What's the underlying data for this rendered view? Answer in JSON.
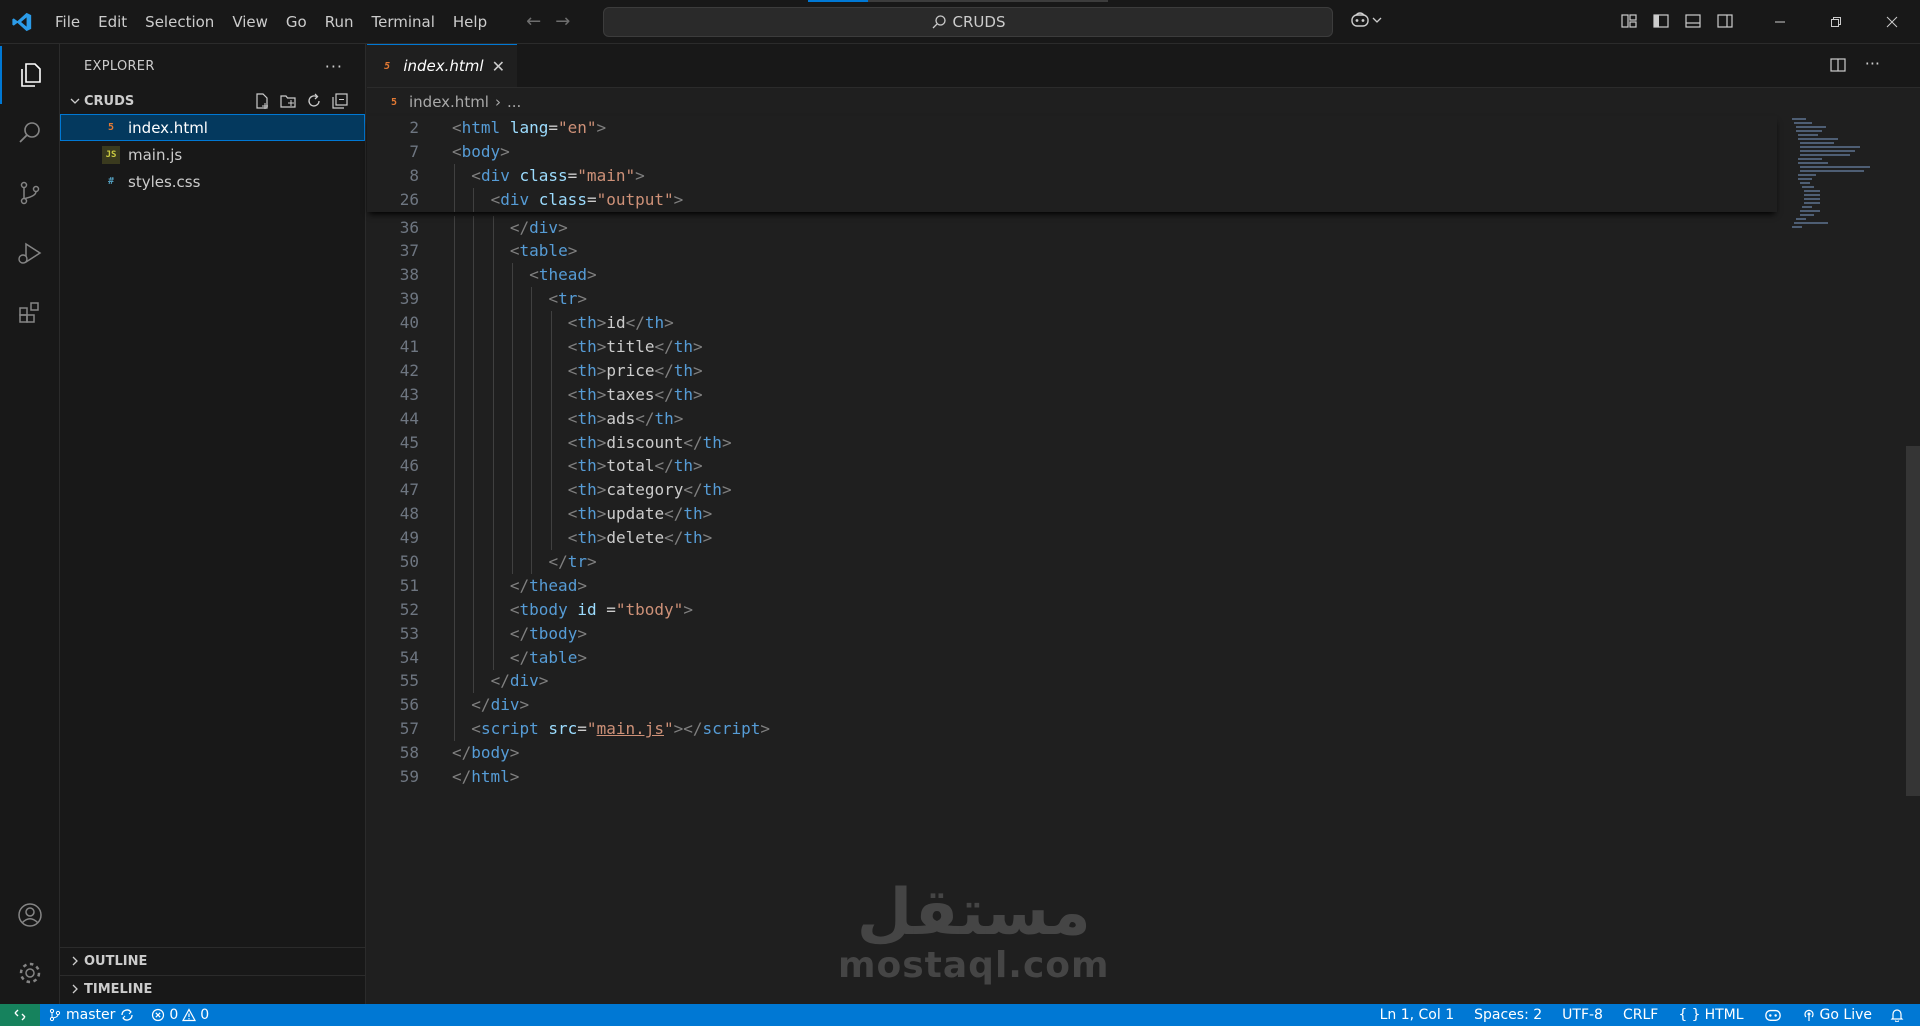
{
  "menu": [
    "File",
    "Edit",
    "Selection",
    "View",
    "Go",
    "Run",
    "Terminal",
    "Help"
  ],
  "search": {
    "label": "CRUDS"
  },
  "sidebar": {
    "title": "EXPLORER",
    "folder": "CRUDS",
    "files": [
      {
        "name": "index.html",
        "type": "html",
        "selected": true
      },
      {
        "name": "main.js",
        "type": "js",
        "selected": false
      },
      {
        "name": "styles.css",
        "type": "css",
        "selected": false
      }
    ],
    "sections": [
      "OUTLINE",
      "TIMELINE"
    ]
  },
  "editor": {
    "tab": "index.html",
    "breadcrumb": [
      "index.html",
      "..."
    ],
    "sticky_lines": [
      {
        "n": "2",
        "indent": 0,
        "tokens": [
          [
            "t",
            "<"
          ],
          [
            "tag",
            "html"
          ],
          [
            "txt",
            " "
          ],
          [
            "attr",
            "lang"
          ],
          [
            "txt",
            "="
          ],
          [
            "str",
            "\"en\""
          ],
          [
            "t",
            ">"
          ]
        ]
      },
      {
        "n": "7",
        "indent": 0,
        "tokens": [
          [
            "t",
            "<"
          ],
          [
            "tag",
            "body"
          ],
          [
            "t",
            ">"
          ]
        ]
      },
      {
        "n": "8",
        "indent": 1,
        "tokens": [
          [
            "t",
            "<"
          ],
          [
            "tag",
            "div"
          ],
          [
            "txt",
            " "
          ],
          [
            "attr",
            "class"
          ],
          [
            "txt",
            "="
          ],
          [
            "str",
            "\"main\""
          ],
          [
            "t",
            ">"
          ]
        ]
      },
      {
        "n": "26",
        "indent": 2,
        "tokens": [
          [
            "t",
            "<"
          ],
          [
            "tag",
            "div"
          ],
          [
            "txt",
            " "
          ],
          [
            "attr",
            "class"
          ],
          [
            "txt",
            "="
          ],
          [
            "str",
            "\"output\""
          ],
          [
            "t",
            ">"
          ]
        ]
      }
    ],
    "lines": [
      {
        "n": "36",
        "indent": 3,
        "tokens": [
          [
            "t",
            "</"
          ],
          [
            "tag",
            "div"
          ],
          [
            "t",
            ">"
          ]
        ]
      },
      {
        "n": "37",
        "indent": 3,
        "tokens": [
          [
            "t",
            "<"
          ],
          [
            "tag",
            "table"
          ],
          [
            "t",
            ">"
          ]
        ]
      },
      {
        "n": "38",
        "indent": 4,
        "tokens": [
          [
            "t",
            "<"
          ],
          [
            "tag",
            "thead"
          ],
          [
            "t",
            ">"
          ]
        ]
      },
      {
        "n": "39",
        "indent": 5,
        "tokens": [
          [
            "t",
            "<"
          ],
          [
            "tag",
            "tr"
          ],
          [
            "t",
            ">"
          ]
        ]
      },
      {
        "n": "40",
        "indent": 6,
        "tokens": [
          [
            "t",
            "<"
          ],
          [
            "tag",
            "th"
          ],
          [
            "t",
            ">"
          ],
          [
            "txt",
            "id"
          ],
          [
            "t",
            "</"
          ],
          [
            "tag",
            "th"
          ],
          [
            "t",
            ">"
          ]
        ]
      },
      {
        "n": "41",
        "indent": 6,
        "tokens": [
          [
            "t",
            "<"
          ],
          [
            "tag",
            "th"
          ],
          [
            "t",
            ">"
          ],
          [
            "txt",
            "title"
          ],
          [
            "t",
            "</"
          ],
          [
            "tag",
            "th"
          ],
          [
            "t",
            ">"
          ]
        ]
      },
      {
        "n": "42",
        "indent": 6,
        "tokens": [
          [
            "t",
            "<"
          ],
          [
            "tag",
            "th"
          ],
          [
            "t",
            ">"
          ],
          [
            "txt",
            "price"
          ],
          [
            "t",
            "</"
          ],
          [
            "tag",
            "th"
          ],
          [
            "t",
            ">"
          ]
        ]
      },
      {
        "n": "43",
        "indent": 6,
        "tokens": [
          [
            "t",
            "<"
          ],
          [
            "tag",
            "th"
          ],
          [
            "t",
            ">"
          ],
          [
            "txt",
            "taxes"
          ],
          [
            "t",
            "</"
          ],
          [
            "tag",
            "th"
          ],
          [
            "t",
            ">"
          ]
        ]
      },
      {
        "n": "44",
        "indent": 6,
        "tokens": [
          [
            "t",
            "<"
          ],
          [
            "tag",
            "th"
          ],
          [
            "t",
            ">"
          ],
          [
            "txt",
            "ads"
          ],
          [
            "t",
            "</"
          ],
          [
            "tag",
            "th"
          ],
          [
            "t",
            ">"
          ]
        ]
      },
      {
        "n": "45",
        "indent": 6,
        "tokens": [
          [
            "t",
            "<"
          ],
          [
            "tag",
            "th"
          ],
          [
            "t",
            ">"
          ],
          [
            "txt",
            "discount"
          ],
          [
            "t",
            "</"
          ],
          [
            "tag",
            "th"
          ],
          [
            "t",
            ">"
          ]
        ]
      },
      {
        "n": "46",
        "indent": 6,
        "tokens": [
          [
            "t",
            "<"
          ],
          [
            "tag",
            "th"
          ],
          [
            "t",
            ">"
          ],
          [
            "txt",
            "total"
          ],
          [
            "t",
            "</"
          ],
          [
            "tag",
            "th"
          ],
          [
            "t",
            ">"
          ]
        ]
      },
      {
        "n": "47",
        "indent": 6,
        "tokens": [
          [
            "t",
            "<"
          ],
          [
            "tag",
            "th"
          ],
          [
            "t",
            ">"
          ],
          [
            "txt",
            "category"
          ],
          [
            "t",
            "</"
          ],
          [
            "tag",
            "th"
          ],
          [
            "t",
            ">"
          ]
        ]
      },
      {
        "n": "48",
        "indent": 6,
        "tokens": [
          [
            "t",
            "<"
          ],
          [
            "tag",
            "th"
          ],
          [
            "t",
            ">"
          ],
          [
            "txt",
            "update"
          ],
          [
            "t",
            "</"
          ],
          [
            "tag",
            "th"
          ],
          [
            "t",
            ">"
          ]
        ]
      },
      {
        "n": "49",
        "indent": 6,
        "tokens": [
          [
            "t",
            "<"
          ],
          [
            "tag",
            "th"
          ],
          [
            "t",
            ">"
          ],
          [
            "txt",
            "delete"
          ],
          [
            "t",
            "</"
          ],
          [
            "tag",
            "th"
          ],
          [
            "t",
            ">"
          ]
        ]
      },
      {
        "n": "50",
        "indent": 5,
        "tokens": [
          [
            "t",
            "</"
          ],
          [
            "tag",
            "tr"
          ],
          [
            "t",
            ">"
          ]
        ]
      },
      {
        "n": "51",
        "indent": 3,
        "tokens": [
          [
            "t",
            "</"
          ],
          [
            "tag",
            "thead"
          ],
          [
            "t",
            ">"
          ]
        ]
      },
      {
        "n": "52",
        "indent": 3,
        "tokens": [
          [
            "t",
            "<"
          ],
          [
            "tag",
            "tbody"
          ],
          [
            "txt",
            " "
          ],
          [
            "attr",
            "id"
          ],
          [
            "txt",
            " ="
          ],
          [
            "str",
            "\"tbody\""
          ],
          [
            "t",
            ">"
          ]
        ]
      },
      {
        "n": "53",
        "indent": 3,
        "tokens": [
          [
            "t",
            "</"
          ],
          [
            "tag",
            "tbody"
          ],
          [
            "t",
            ">"
          ]
        ]
      },
      {
        "n": "54",
        "indent": 3,
        "tokens": [
          [
            "t",
            "</"
          ],
          [
            "tag",
            "table"
          ],
          [
            "t",
            ">"
          ]
        ]
      },
      {
        "n": "55",
        "indent": 2,
        "tokens": [
          [
            "t",
            "</"
          ],
          [
            "tag",
            "div"
          ],
          [
            "t",
            ">"
          ]
        ]
      },
      {
        "n": "56",
        "indent": 1,
        "tokens": [
          [
            "t",
            "</"
          ],
          [
            "tag",
            "div"
          ],
          [
            "t",
            ">"
          ]
        ]
      },
      {
        "n": "57",
        "indent": 1,
        "tokens": [
          [
            "t",
            "<"
          ],
          [
            "tag",
            "script"
          ],
          [
            "txt",
            " "
          ],
          [
            "attr",
            "src"
          ],
          [
            "txt",
            "="
          ],
          [
            "str",
            "\""
          ],
          [
            "strlink",
            "main.js"
          ],
          [
            "str",
            "\""
          ],
          [
            "t",
            "></"
          ],
          [
            "tag",
            "script"
          ],
          [
            "t",
            ">"
          ]
        ]
      },
      {
        "n": "58",
        "indent": 0,
        "tokens": [
          [
            "t",
            "</"
          ],
          [
            "tag",
            "body"
          ],
          [
            "t",
            ">"
          ]
        ]
      },
      {
        "n": "59",
        "indent": 0,
        "tokens": [
          [
            "t",
            "</"
          ],
          [
            "tag",
            "html"
          ],
          [
            "t",
            ">"
          ]
        ]
      }
    ]
  },
  "watermark": {
    "arabic": "مستقل",
    "latin": "mostaql.com"
  },
  "statusbar": {
    "branch": "master",
    "errors": "0",
    "warnings": "0",
    "position": "Ln 1, Col 1",
    "spaces": "Spaces: 2",
    "encoding": "UTF-8",
    "eol": "CRLF",
    "language": "HTML",
    "golive": "Go Live"
  },
  "colors": {
    "accent": "#0078d4",
    "remote": "#16825d",
    "tag": "#569cd6",
    "attr": "#9cdcfe",
    "string": "#ce9178"
  }
}
